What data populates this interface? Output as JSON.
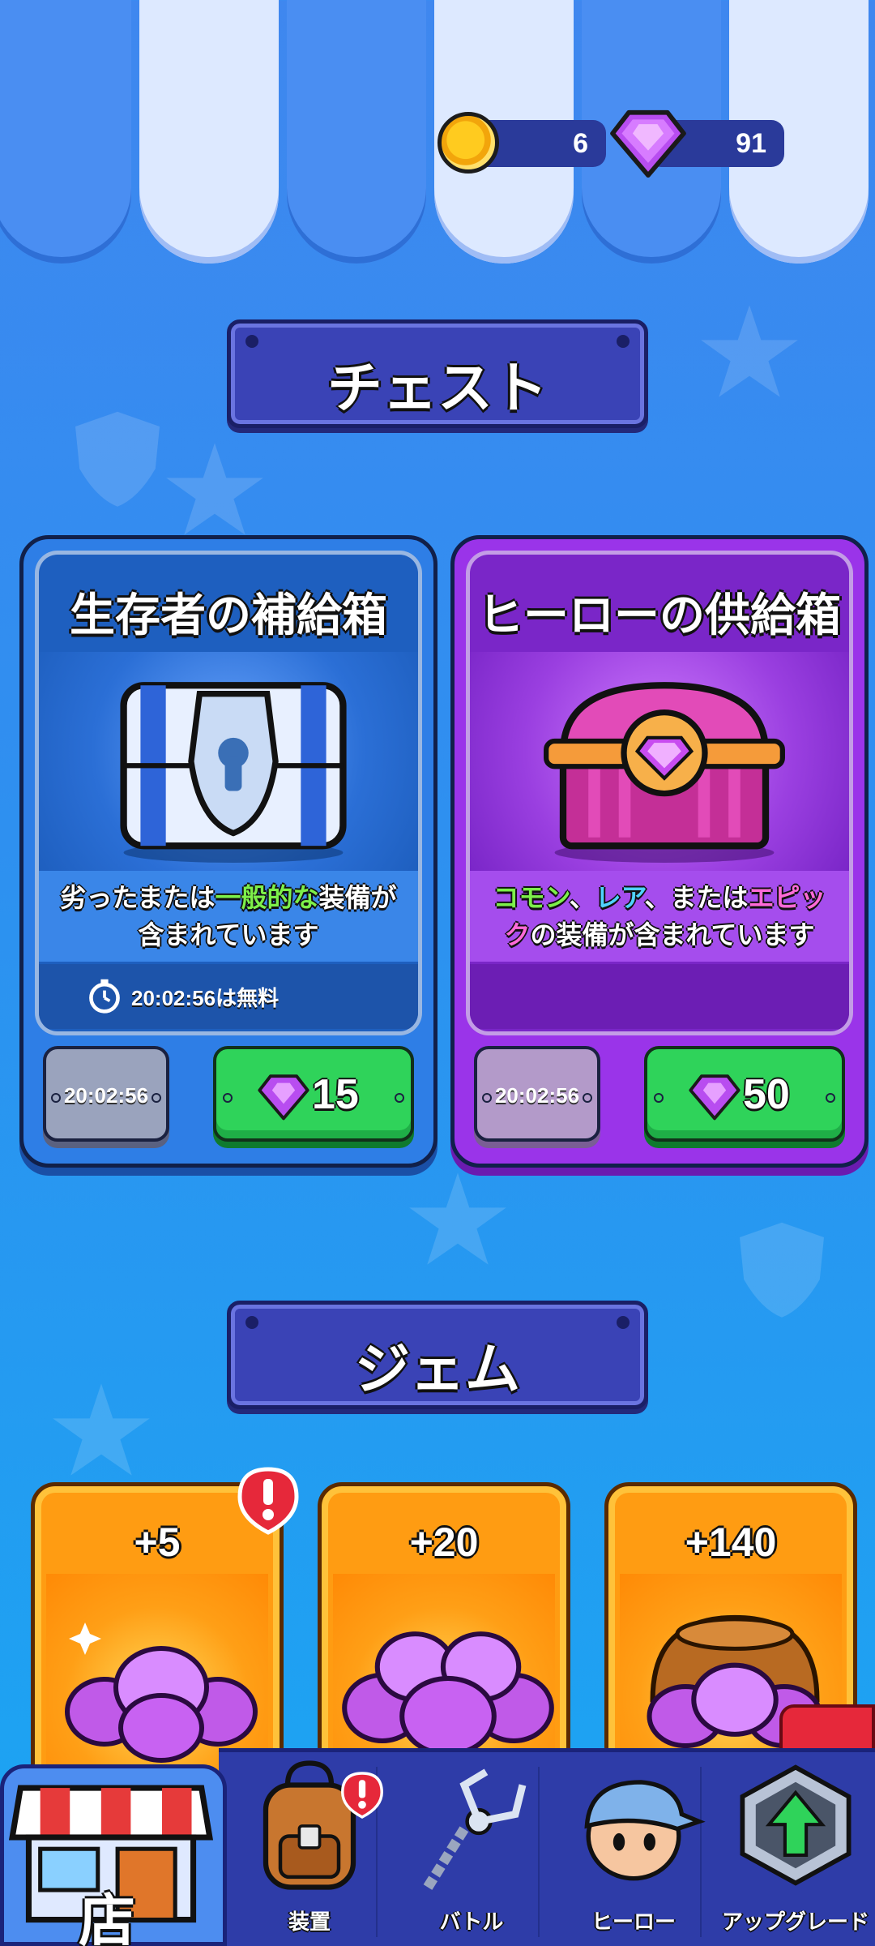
{
  "currency": {
    "coins": "6",
    "gems": "91"
  },
  "sections": {
    "chests_title": "チェスト",
    "gems_title": "ジェム"
  },
  "chests": [
    {
      "title": "生存者の補給箱",
      "desc_line1_pre": "劣ったまたは",
      "desc_line1_hl": "一般的な",
      "desc_line1_post": "装備が",
      "desc_line2": "含まれています",
      "free_timer": "20:02:56は無料",
      "timer": "20:02:56",
      "price": "15"
    },
    {
      "title": "ヒーローの供給箱",
      "desc_common": "コモン",
      "desc_sep1": "、",
      "desc_rare": "レア",
      "desc_sep2": "、または",
      "desc_epic": "エピッ",
      "desc_epic2": "ク",
      "desc_line2_rest": "の装備が含まれています",
      "timer": "20:02:56",
      "price": "50"
    }
  ],
  "gem_packs": [
    {
      "amount": "+5",
      "alert": "!"
    },
    {
      "amount": "+20"
    },
    {
      "amount": "+140"
    }
  ],
  "nav": {
    "store": "店",
    "equipment": "装置",
    "equipment_alert": "!",
    "battle": "バトル",
    "hero": "ヒーロー",
    "upgrade": "アップグレード"
  },
  "colors": {
    "chest_blue": "#2e7ee6",
    "chest_purple": "#9a34e9",
    "buy_green": "#2fd35a",
    "gem_card_orange": "#ff9c12",
    "nav_bar": "#2e3ca8"
  },
  "icons": [
    "coin-icon",
    "gem-icon",
    "timer-icon",
    "alert-icon",
    "backpack-icon",
    "claw-chain-icon",
    "hero-face-icon",
    "upgrade-arrow-icon",
    "shop-icon"
  ]
}
